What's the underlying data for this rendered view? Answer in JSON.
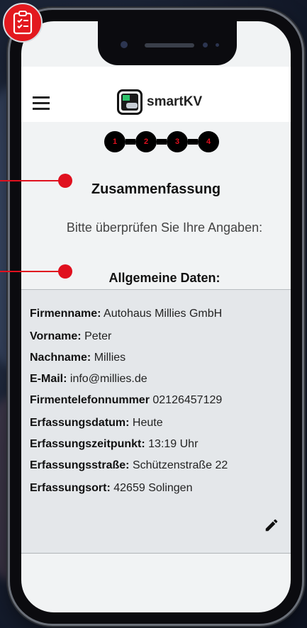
{
  "app": {
    "name": "smartKV"
  },
  "steps": [
    "1",
    "2",
    "3",
    "4"
  ],
  "page": {
    "title": "Zusammenfassung",
    "subtitle": "Bitte überprüfen Sie Ihre Angaben:",
    "section_title": "Allgemeine Daten:"
  },
  "fields": [
    {
      "label": "Firmenname:",
      "value": "Autohaus Millies GmbH"
    },
    {
      "label": "Vorname:",
      "value": "Peter"
    },
    {
      "label": "Nachname:",
      "value": "Millies"
    },
    {
      "label": "E-Mail:",
      "value": "info@millies.de"
    },
    {
      "label": "Firmentelefonnummer",
      "value": "02126457129"
    },
    {
      "label": "Erfassungsdatum:",
      "value": "Heute"
    },
    {
      "label": "Erfassungszeitpunkt:",
      "value": "13:19 Uhr"
    },
    {
      "label": "Erfassungsstraße:",
      "value": "Schützenstraße 22"
    },
    {
      "label": "Erfassungsort:",
      "value": "42659 Solingen"
    }
  ],
  "colors": {
    "accent": "#e0101e",
    "badge": "#e3191f",
    "card": "#e4e7ea"
  },
  "icons": {
    "badge": "checklist-icon",
    "menu": "hamburger-menu-icon",
    "edit": "pencil-icon"
  }
}
